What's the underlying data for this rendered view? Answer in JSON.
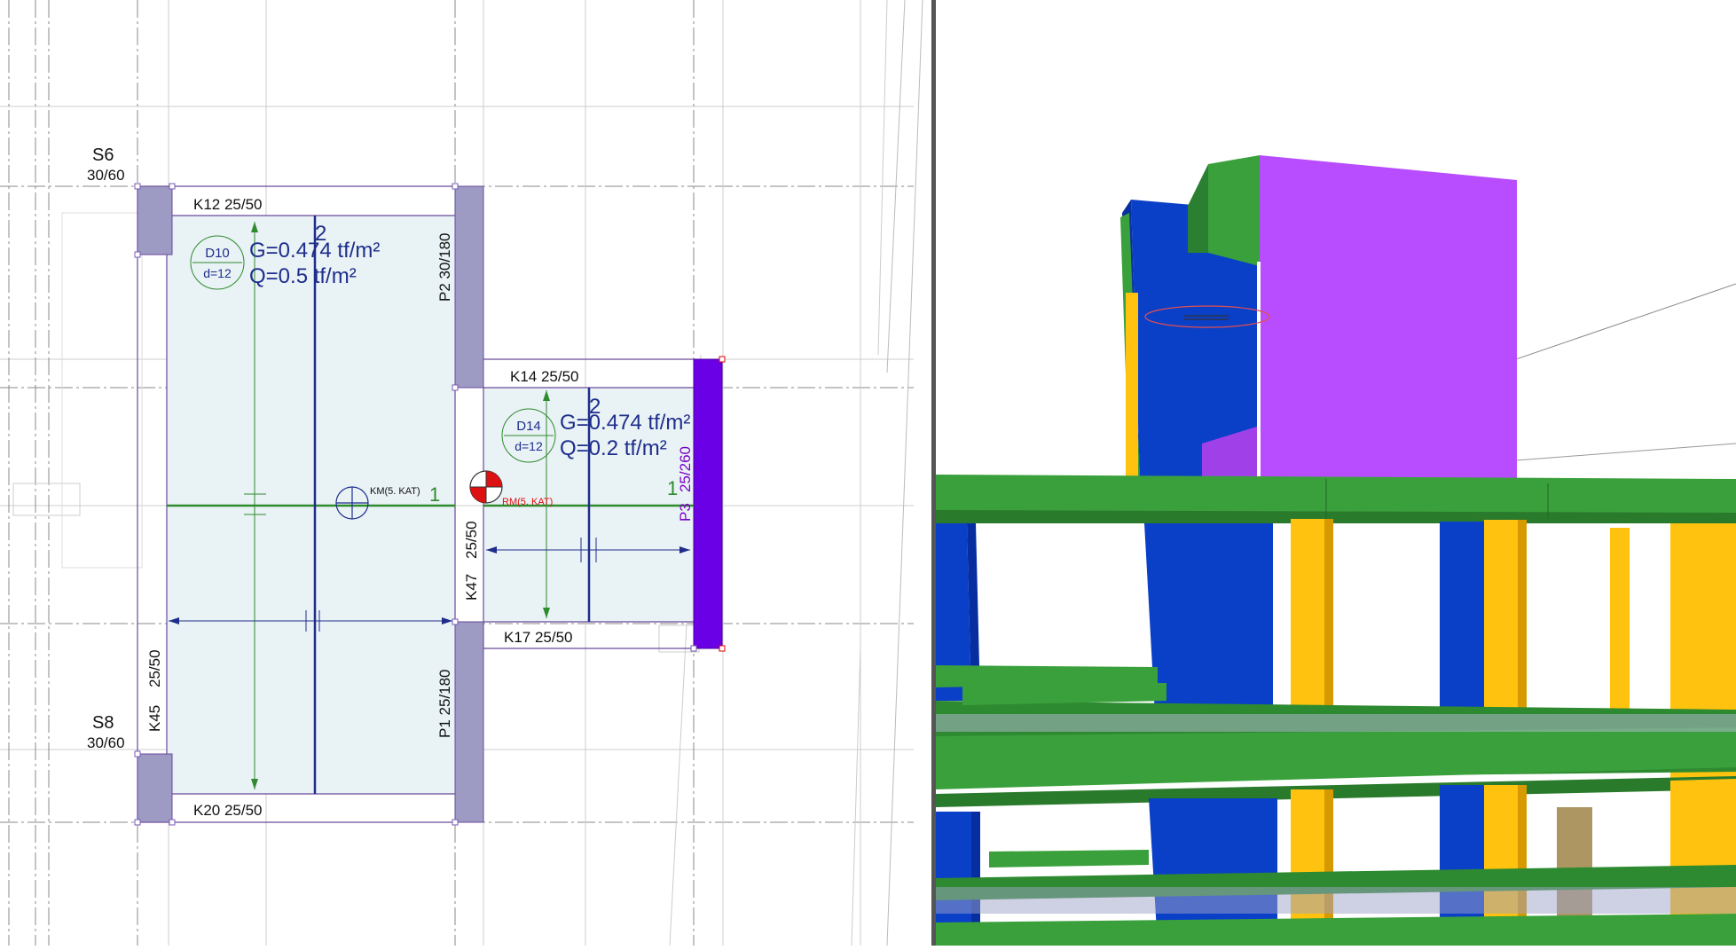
{
  "plan": {
    "columns": {
      "s6": {
        "name": "S6",
        "size": "30/60"
      },
      "s8": {
        "name": "S8",
        "size": "30/60"
      },
      "p1": "P1 25/180",
      "p2": "P2 30/180",
      "p3_name": "P3",
      "p3_size": "25/260"
    },
    "beams": {
      "k12": "K12   25/50",
      "k14": "K14   25/50",
      "k17": "K17 25/50",
      "k20": "K20   25/50",
      "k45_name": "K45",
      "k45_size": "25/50",
      "k47_name": "K47",
      "k47_size": "25/50"
    },
    "slab_d10": {
      "id": "D10",
      "thickness": "d=12",
      "g_load": "G=0.474 tf/m²",
      "q_load": "Q=0.5  tf/m²",
      "direction_mark": "2"
    },
    "slab_d14": {
      "id": "D14",
      "thickness": "d=12",
      "g_load": "G=0.474 tf/m²",
      "q_load": "Q=0.2  tf/m²",
      "direction_mark": "2"
    },
    "mass_center_label": "KM(5. KAT)",
    "rigidity_center_label": "RM(5. KAT)",
    "axis_mark_1a": "1",
    "axis_mark_1b": "1"
  },
  "colors": {
    "grid": "#888888",
    "slab": "#e9f2f5",
    "column_gray": "#9d9bc4",
    "column_purple": "#6a00e6",
    "green": "#2e8b2e",
    "navy": "#1e2d8c",
    "beam3d_green": "#3aa03c",
    "wall_blue": "#0a3fc7",
    "wall_violet": "#b84cff",
    "column_yellow": "#ffc20e"
  }
}
